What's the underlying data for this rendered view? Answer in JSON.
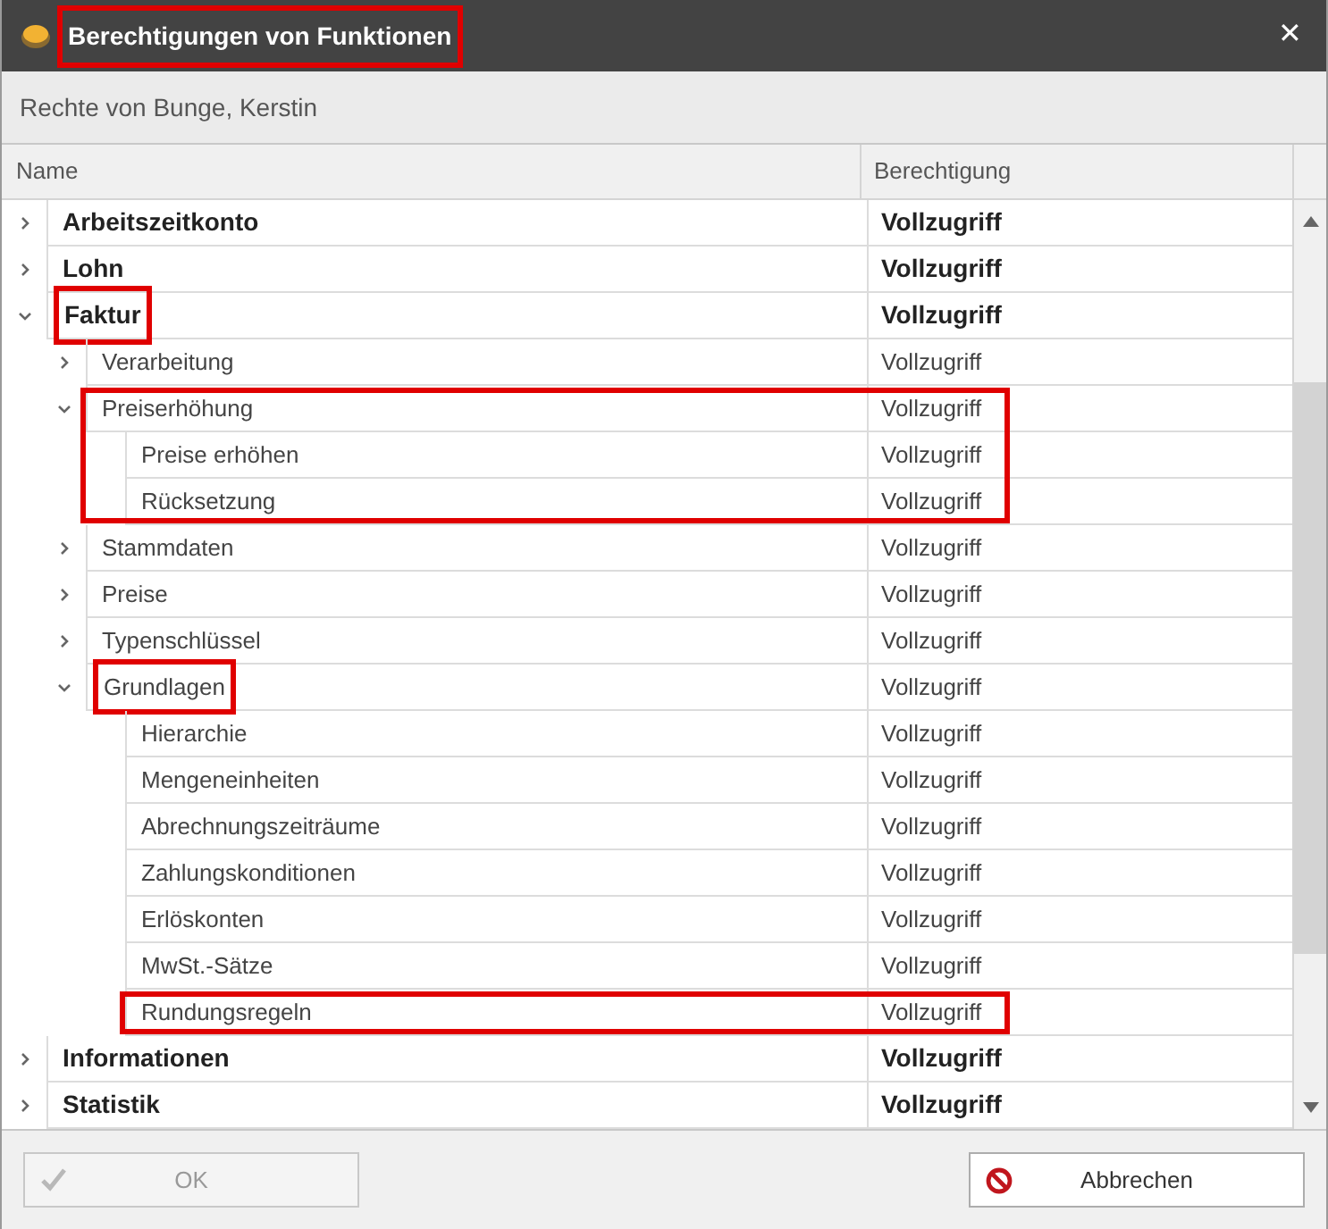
{
  "window": {
    "title": "Berechtigungen von Funktionen",
    "title_highlighted": true,
    "close": "✕"
  },
  "subtitle": "Rechte von Bunge, Kerstin",
  "columns": [
    "Name",
    "Berechtigung"
  ],
  "rows": [
    {
      "name": "Arbeitszeitkonto",
      "permission": "Vollzugriff",
      "expanded": false
    },
    {
      "name": "Lohn",
      "permission": "Vollzugriff",
      "expanded": false
    },
    {
      "name": "Faktur",
      "permission": "Vollzugriff",
      "expanded": true,
      "name_highlighted": true,
      "children": [
        {
          "name": "Verarbeitung",
          "permission": "Vollzugriff",
          "expanded": false
        },
        {
          "name": "Preiserhöhung",
          "permission": "Vollzugriff",
          "expanded": true,
          "row_highlighted": true,
          "children": [
            {
              "name": "Preise erhöhen",
              "permission": "Vollzugriff"
            },
            {
              "name": "Rücksetzung",
              "permission": "Vollzugriff"
            }
          ]
        },
        {
          "name": "Stammdaten",
          "permission": "Vollzugriff",
          "expanded": false
        },
        {
          "name": "Preise",
          "permission": "Vollzugriff",
          "expanded": false
        },
        {
          "name": "Typenschlüssel",
          "permission": "Vollzugriff",
          "expanded": false
        },
        {
          "name": "Grundlagen",
          "permission": "Vollzugriff",
          "expanded": true,
          "name_highlighted": true,
          "children": [
            {
              "name": "Hierarchie",
              "permission": "Vollzugriff"
            },
            {
              "name": "Mengeneinheiten",
              "permission": "Vollzugriff"
            },
            {
              "name": "Abrechnungszeiträume",
              "permission": "Vollzugriff"
            },
            {
              "name": "Zahlungskonditionen",
              "permission": "Vollzugriff"
            },
            {
              "name": "Erlöskonten",
              "permission": "Vollzugriff"
            },
            {
              "name": "MwSt.-Sätze",
              "permission": "Vollzugriff"
            },
            {
              "name": "Rundungsregeln",
              "permission": "Vollzugriff",
              "row_highlighted": true
            }
          ]
        }
      ]
    },
    {
      "name": "Informationen",
      "permission": "Vollzugriff",
      "expanded": false
    },
    {
      "name": "Statistik",
      "permission": "Vollzugriff",
      "expanded": false
    }
  ],
  "buttons": [
    {
      "label": "OK",
      "disabled": true,
      "kind": "ok"
    },
    {
      "label": "Abbrechen",
      "disabled": false,
      "kind": "cancel"
    }
  ]
}
